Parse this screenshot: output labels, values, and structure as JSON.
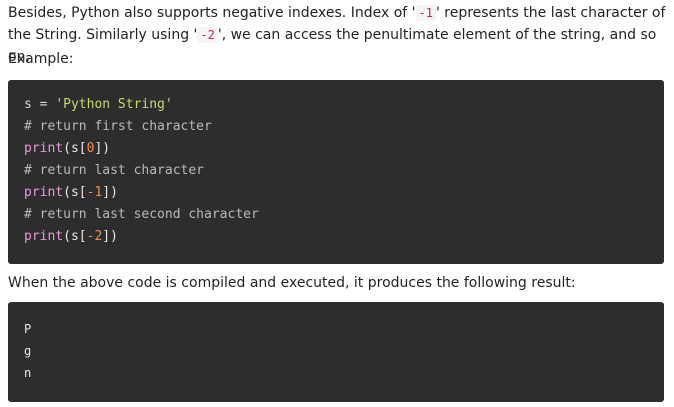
{
  "intro": {
    "text_1": "Besides, Python also supports negative indexes. Index of '",
    "code_1": "-1",
    "text_2": "' represents the last character of the String. Similarly using '",
    "code_2": "-2",
    "text_3": "', we can access the penultimate element of the string, and so on."
  },
  "example_label": "Example:",
  "code": {
    "l1_var": "s",
    "l1_op": " = ",
    "l1_str": "'Python String'",
    "l2_comment": "# return first character",
    "l3_fn": "print",
    "l3_open": "(s[",
    "l3_num": "0",
    "l3_close": "])",
    "l4_comment": "# return last character",
    "l5_fn": "print",
    "l5_open": "(s[",
    "l5_num": "-1",
    "l5_close": "])",
    "l6_comment": "# return last second character",
    "l7_fn": "print",
    "l7_open": "(s[",
    "l7_num": "-2",
    "l7_close": "])"
  },
  "result_text": "When the above code is compiled and executed, it produces the following result:",
  "output": {
    "lines": [
      "P",
      "g",
      "n"
    ]
  },
  "colors": {
    "code_background": "#2d2d2d",
    "inline_code": "#c7254e",
    "string": "#c9d96a",
    "function": "#e79ad9",
    "number": "#f08d49",
    "comment": "#b9b9b9"
  }
}
